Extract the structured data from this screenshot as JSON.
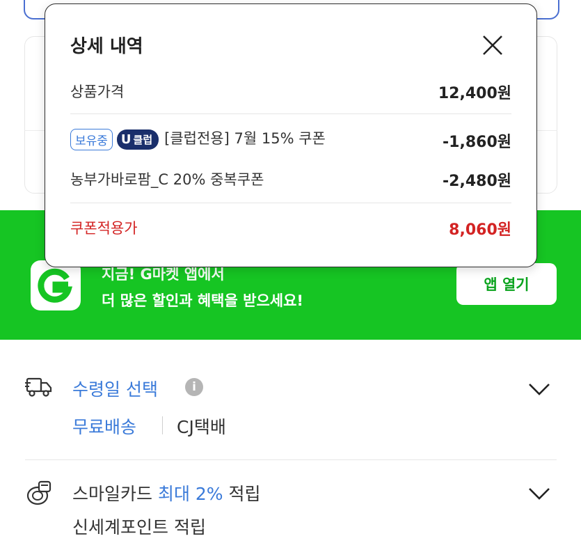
{
  "popup": {
    "title": "상세 내역",
    "price_label": "상품가격",
    "price_value": "12,400원",
    "coupon1": {
      "owned_badge": "보유중",
      "club_badge_u": "U",
      "club_badge_text": "클럽",
      "label": "[클럽전용] 7월 15% 쿠폰",
      "value": "-1,860원"
    },
    "coupon2": {
      "label": "농부가바로팜_C 20% 중복쿠폰",
      "value": "-2,480원"
    },
    "final_label": "쿠폰적용가",
    "final_value": "8,060원"
  },
  "banner": {
    "line1": "지금! G마켓 앱에서",
    "line2": "더 많은 할인과 혜택을 받으세요!",
    "button": "앱 열기",
    "logo_letter": "G"
  },
  "shipping": {
    "title": "수령일 선택",
    "info_icon": "i",
    "free": "무료배송",
    "carrier": "CJ택배"
  },
  "card": {
    "title_prefix": "스마일카드 ",
    "title_highlight": "최대 2%",
    "title_suffix": " 적립",
    "sub": "신세계포인트 적립"
  },
  "colors": {
    "accent_blue": "#3a7ad9",
    "banner_green": "#16c523",
    "price_red": "#d32323",
    "club_navy": "#1a2f6b"
  }
}
